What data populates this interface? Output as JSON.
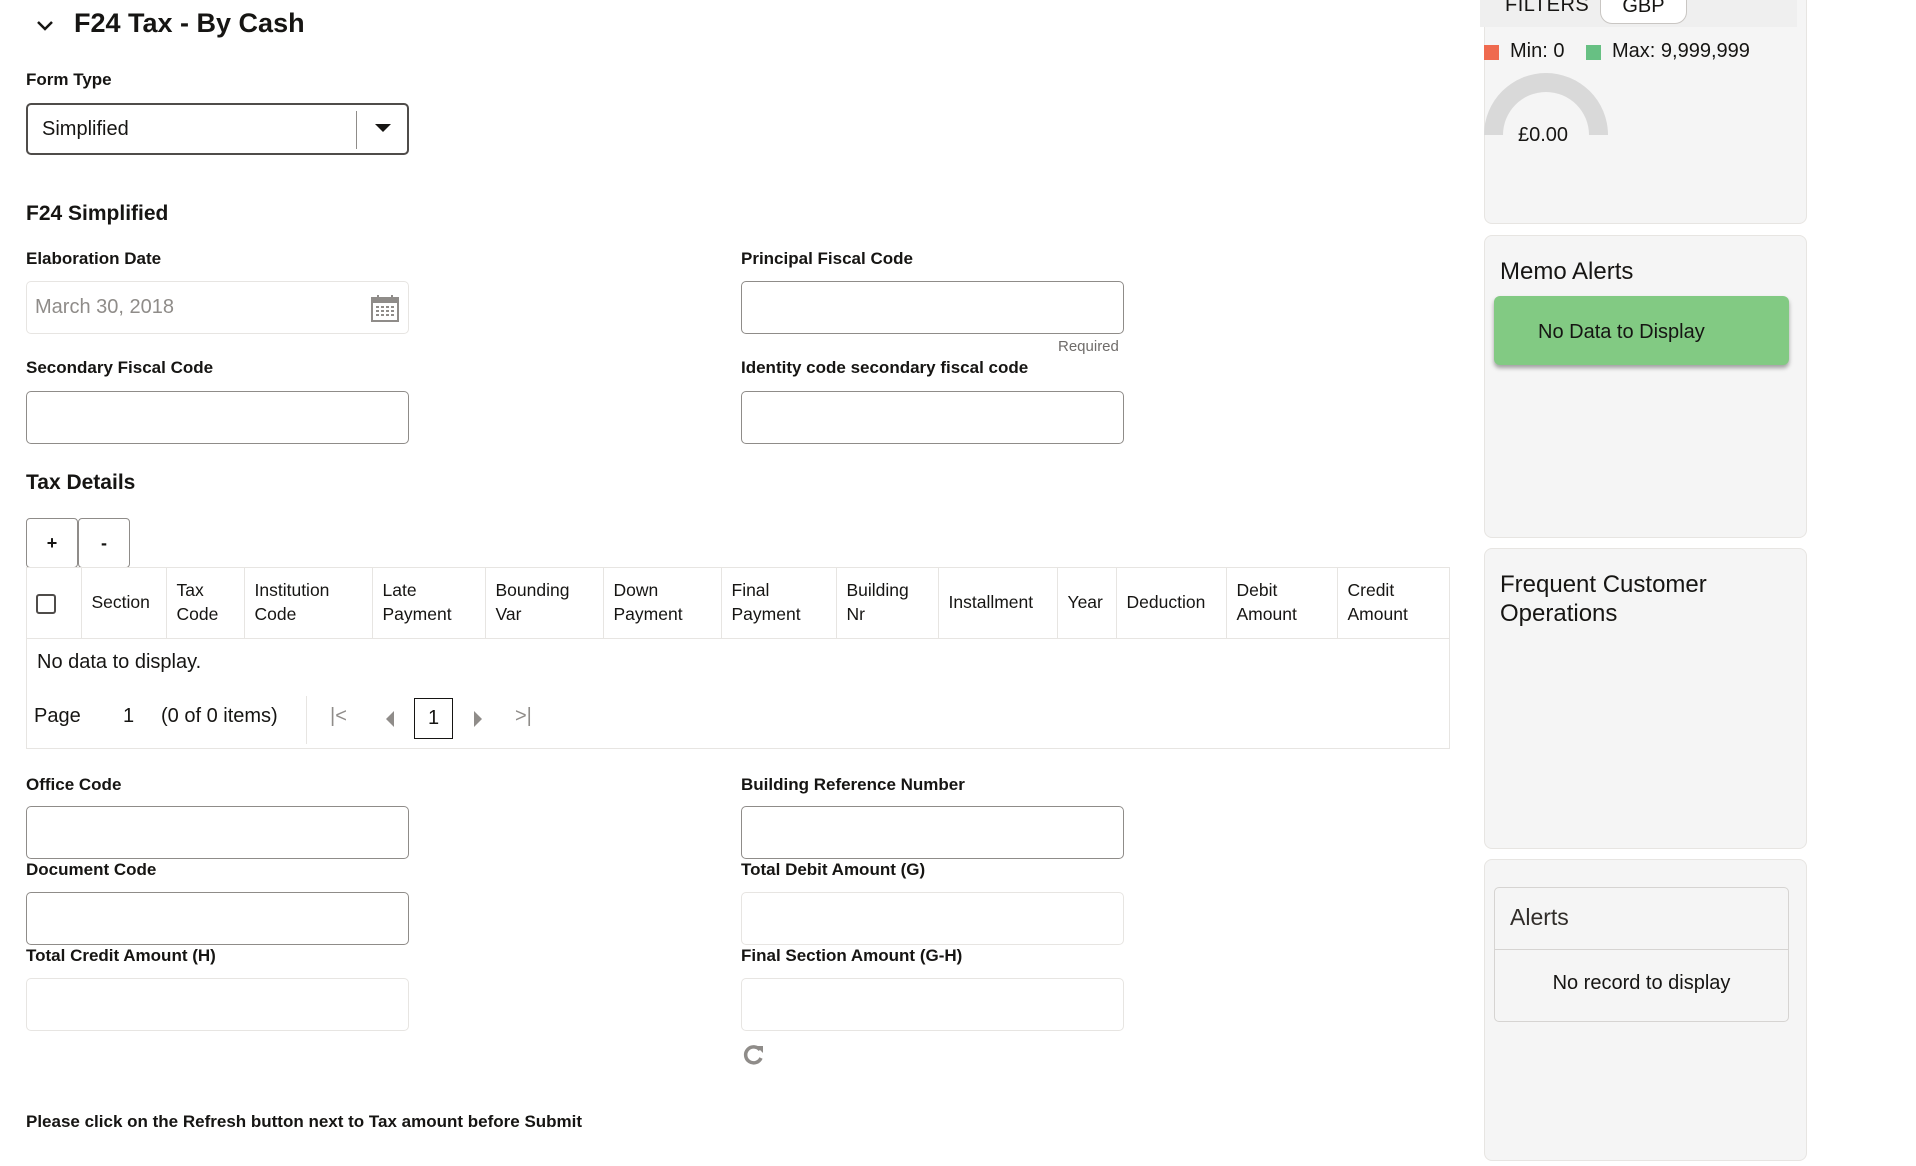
{
  "header": {
    "title": "F24 Tax - By Cash",
    "collapse_icon": "chevron-down-icon"
  },
  "form_type": {
    "label": "Form Type",
    "value": "Simplified"
  },
  "section_title": "F24 Simplified",
  "fields": {
    "elaboration_date": {
      "label": "Elaboration Date",
      "value": "March 30, 2018",
      "icon": "calendar-icon"
    },
    "principal_fiscal_code": {
      "label": "Principal Fiscal Code",
      "value": "",
      "hint": "Required"
    },
    "secondary_fiscal_code": {
      "label": "Secondary Fiscal Code",
      "value": ""
    },
    "identity_code_secondary": {
      "label": "Identity code secondary fiscal code",
      "value": ""
    },
    "office_code": {
      "label": "Office Code",
      "value": ""
    },
    "building_reference_number": {
      "label": "Building Reference Number",
      "value": ""
    },
    "document_code": {
      "label": "Document Code",
      "value": ""
    },
    "total_debit_amount": {
      "label": "Total Debit Amount (G)",
      "value": ""
    },
    "total_credit_amount": {
      "label": "Total Credit Amount (H)",
      "value": ""
    },
    "final_section_amount": {
      "label": "Final Section Amount (G-H)",
      "value": ""
    }
  },
  "tax_details": {
    "title": "Tax Details",
    "add_label": "+",
    "remove_label": "-",
    "columns": [
      "Section",
      "Tax Code",
      "Institution Code",
      "Late Payment",
      "Bounding Var",
      "Down Payment",
      "Final Payment",
      "Building Nr",
      "Installment",
      "Year",
      "Deduction",
      "Debit Amount",
      "Credit Amount"
    ],
    "rows": [],
    "empty_text": "No data to display.",
    "pagination": {
      "page_label": "Page",
      "page": "1",
      "summary": "(0 of 0 items)",
      "current": "1"
    }
  },
  "note": "Please click on the Refresh button next to Tax amount before Submit",
  "sidebar": {
    "filters": {
      "label": "FILTERS",
      "currency": "GBP"
    },
    "gauge": {
      "min_label": "Min: 0",
      "max_label": "Max: 9,999,999",
      "value": "£0.00",
      "value_fraction": 0,
      "min_color": "#ef6a4f",
      "max_color": "#67c083",
      "track_color": "#d9d9d9"
    },
    "memo_alerts": {
      "title": "Memo Alerts",
      "empty_text": "No Data to Display",
      "color": "#82ca83"
    },
    "frequent_ops": {
      "title": "Frequent Customer Operations"
    },
    "alerts": {
      "title": "Alerts",
      "empty_text": "No record to display"
    }
  }
}
